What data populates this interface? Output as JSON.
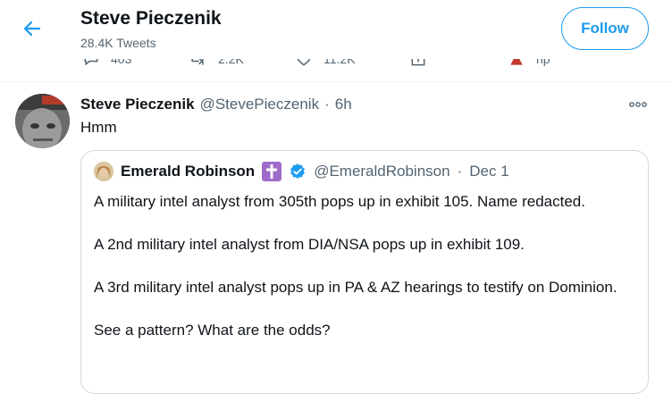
{
  "header": {
    "name": "Steve Pieczenik",
    "tweet_count": "28.4K Tweets",
    "follow_label": "Follow"
  },
  "previous_tweet_actions": {
    "replies": "403",
    "retweets": "2.2K",
    "likes": "11.2K",
    "extra_label": "np"
  },
  "tweet": {
    "author_name": "Steve Pieczenik",
    "author_handle": "@StevePieczenik",
    "separator": "·",
    "time": "6h",
    "text": "Hmm"
  },
  "quoted_tweet": {
    "author_name": "Emerald Robinson",
    "author_handle": "@EmeraldRobinson",
    "separator": "·",
    "date": "Dec 1",
    "paragraphs": [
      "A military intel analyst from 305th pops up in exhibit 105. Name redacted.",
      "A 2nd military intel analyst from DIA/NSA pops up in exhibit 109.",
      "A 3rd military intel analyst pops up in PA & AZ hearings to testify on Dominion.",
      "See a pattern? What are the odds?"
    ]
  },
  "colors": {
    "accent": "#1d9bf0",
    "text": "#0f1419",
    "secondary_text": "#536471",
    "border": "#cfd9de",
    "badge_purple": "#9f6bc9"
  },
  "icons": {
    "back": "arrow-left-icon",
    "more": "more-horizontal-icon",
    "verified": "verified-badge-icon",
    "cross": "latin-cross-icon"
  }
}
